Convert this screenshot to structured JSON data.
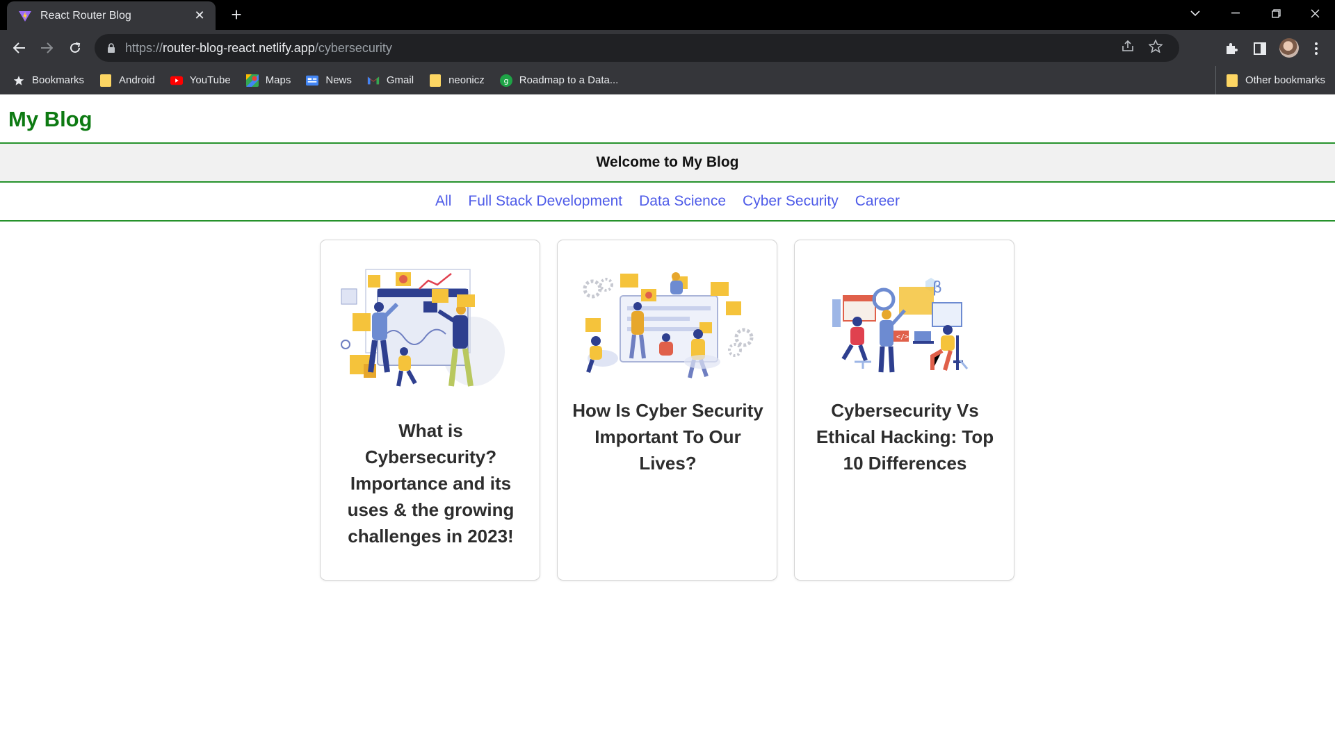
{
  "browser": {
    "tab_title": "React Router Blog",
    "tab_close": "✕",
    "new_tab": "+",
    "url_scheme": "https://",
    "url_host": "router-blog-react.netlify.app",
    "url_path": "/cybersecurity",
    "bookmarks": [
      {
        "label": "Bookmarks",
        "icon": "star-icon"
      },
      {
        "label": "Android",
        "icon": "folder-icon"
      },
      {
        "label": "YouTube",
        "icon": "youtube-icon"
      },
      {
        "label": "Maps",
        "icon": "maps-icon"
      },
      {
        "label": "News",
        "icon": "news-icon"
      },
      {
        "label": "Gmail",
        "icon": "gmail-icon"
      },
      {
        "label": "neonicz",
        "icon": "folder-icon"
      },
      {
        "label": "Roadmap to a Data...",
        "icon": "roadmap-icon"
      }
    ],
    "other_bookmarks": "Other bookmarks"
  },
  "site": {
    "brand": "My Blog",
    "welcome": "Welcome to My Blog",
    "categories": [
      "All",
      "Full Stack Development",
      "Data Science",
      "Cyber Security",
      "Career"
    ]
  },
  "posts": [
    {
      "title": "What is Cybersecurity? Importance and its uses & the growing challenges in 2023!",
      "image": "team-dashboard-illustration"
    },
    {
      "title": "How Is Cyber Security Important To Our Lives?",
      "image": "team-collaboration-illustration"
    },
    {
      "title": "Cybersecurity Vs Ethical Hacking: Top 10 Differences",
      "image": "developers-coding-illustration"
    }
  ],
  "colors": {
    "brand": "#0d7a12",
    "divider": "#26922b",
    "link": "#4e5be8",
    "illustration_yellow": "#f5c33b",
    "illustration_blue": "#2e3f8f"
  }
}
